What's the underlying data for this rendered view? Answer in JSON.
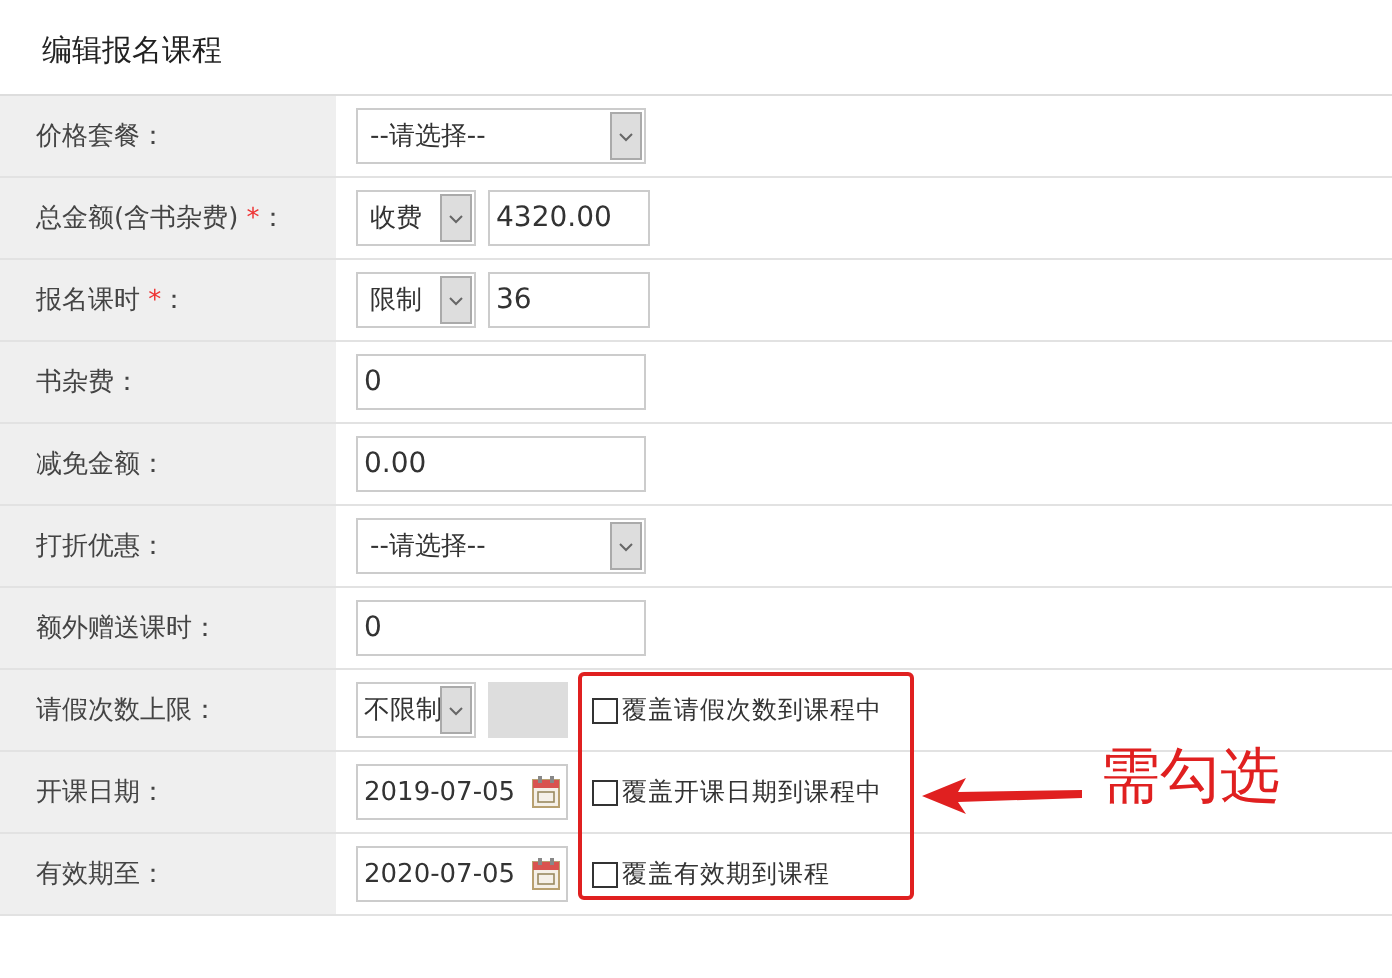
{
  "title": "编辑报名课程",
  "rows": [
    {
      "label": "价格套餐：",
      "kind": "select",
      "select": "--请选择--"
    },
    {
      "label": "总金额(含书杂费) ",
      "required_mark": "*",
      "label_end": "：",
      "kind": "select_input",
      "select": "收费",
      "value": "4320.00"
    },
    {
      "label": "报名课时 ",
      "required_mark": "*",
      "label_end": "：",
      "kind": "select_input",
      "select": "限制",
      "value": "36"
    },
    {
      "label": "书杂费：",
      "kind": "input",
      "value": "0"
    },
    {
      "label": "减免金额：",
      "kind": "input",
      "value": "0.00"
    },
    {
      "label": "打折优惠：",
      "kind": "select",
      "select": "--请选择--"
    },
    {
      "label": "额外赠送课时：",
      "kind": "input",
      "value": "0"
    },
    {
      "label": "请假次数上限：",
      "kind": "leave",
      "select": "不限制",
      "disabled": true,
      "option": {
        "label": "覆盖请假次数到课程中",
        "checked": false
      }
    },
    {
      "label": "开课日期：",
      "kind": "date",
      "value": "2019-07-05",
      "option": {
        "label": "覆盖开课日期到课程中",
        "checked": false
      }
    },
    {
      "label": "有效期至：",
      "kind": "date",
      "value": "2020-07-05",
      "option": {
        "label": "覆盖有效期到课程",
        "checked": false
      }
    }
  ],
  "annotation": {
    "text": "需勾选"
  }
}
